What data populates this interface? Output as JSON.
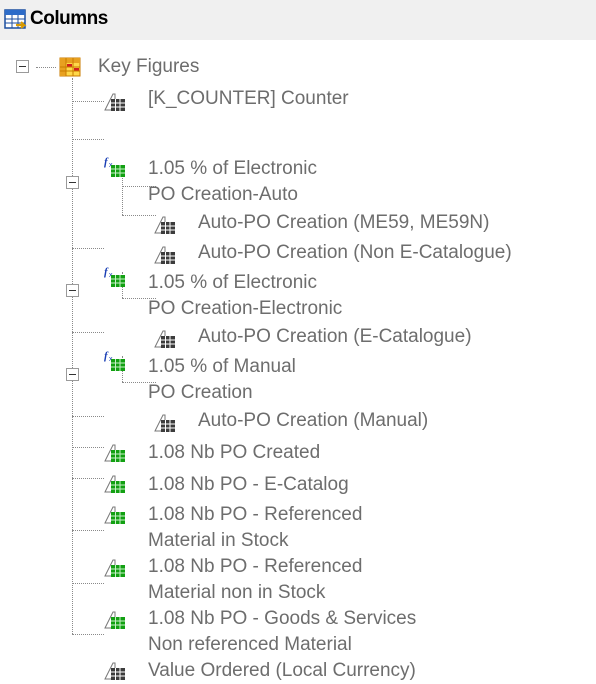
{
  "header": {
    "title": "Columns",
    "icon": "columns-grid-icon"
  },
  "tree": {
    "root": {
      "label": "Key Figures",
      "icon": "key-figures-icon"
    },
    "nodes": {
      "counter": "[K_COUNTER] Counter",
      "f1": [
        "1.05 % of Electronic",
        "PO Creation-Auto"
      ],
      "f1c1": "Auto-PO Creation (ME59, ME59N)",
      "f1c2": "Auto-PO Creation (Non E-Catalogue)",
      "f2": [
        "1.05 % of Electronic",
        "PO Creation-Electronic"
      ],
      "f2c1": "Auto-PO Creation (E-Catalogue)",
      "f3": [
        "1.05 % of Manual",
        "PO Creation"
      ],
      "f3c1": "Auto-PO Creation (Manual)",
      "k1": "1.08 Nb PO Created",
      "k2": "1.08 Nb PO - E-Catalog",
      "k3": [
        "1.08 Nb PO - Referenced",
        "Material in Stock"
      ],
      "k4": [
        "1.08 Nb PO - Referenced",
        "Material non in Stock"
      ],
      "k5": [
        "1.08 Nb PO - Goods & Services",
        "Non referenced Material"
      ],
      "value": "Value Ordered (Local Currency)"
    }
  },
  "colors": {
    "text": "#6d6d6d",
    "green_icon": "#12a012",
    "dark_icon": "#3c3c3c"
  }
}
